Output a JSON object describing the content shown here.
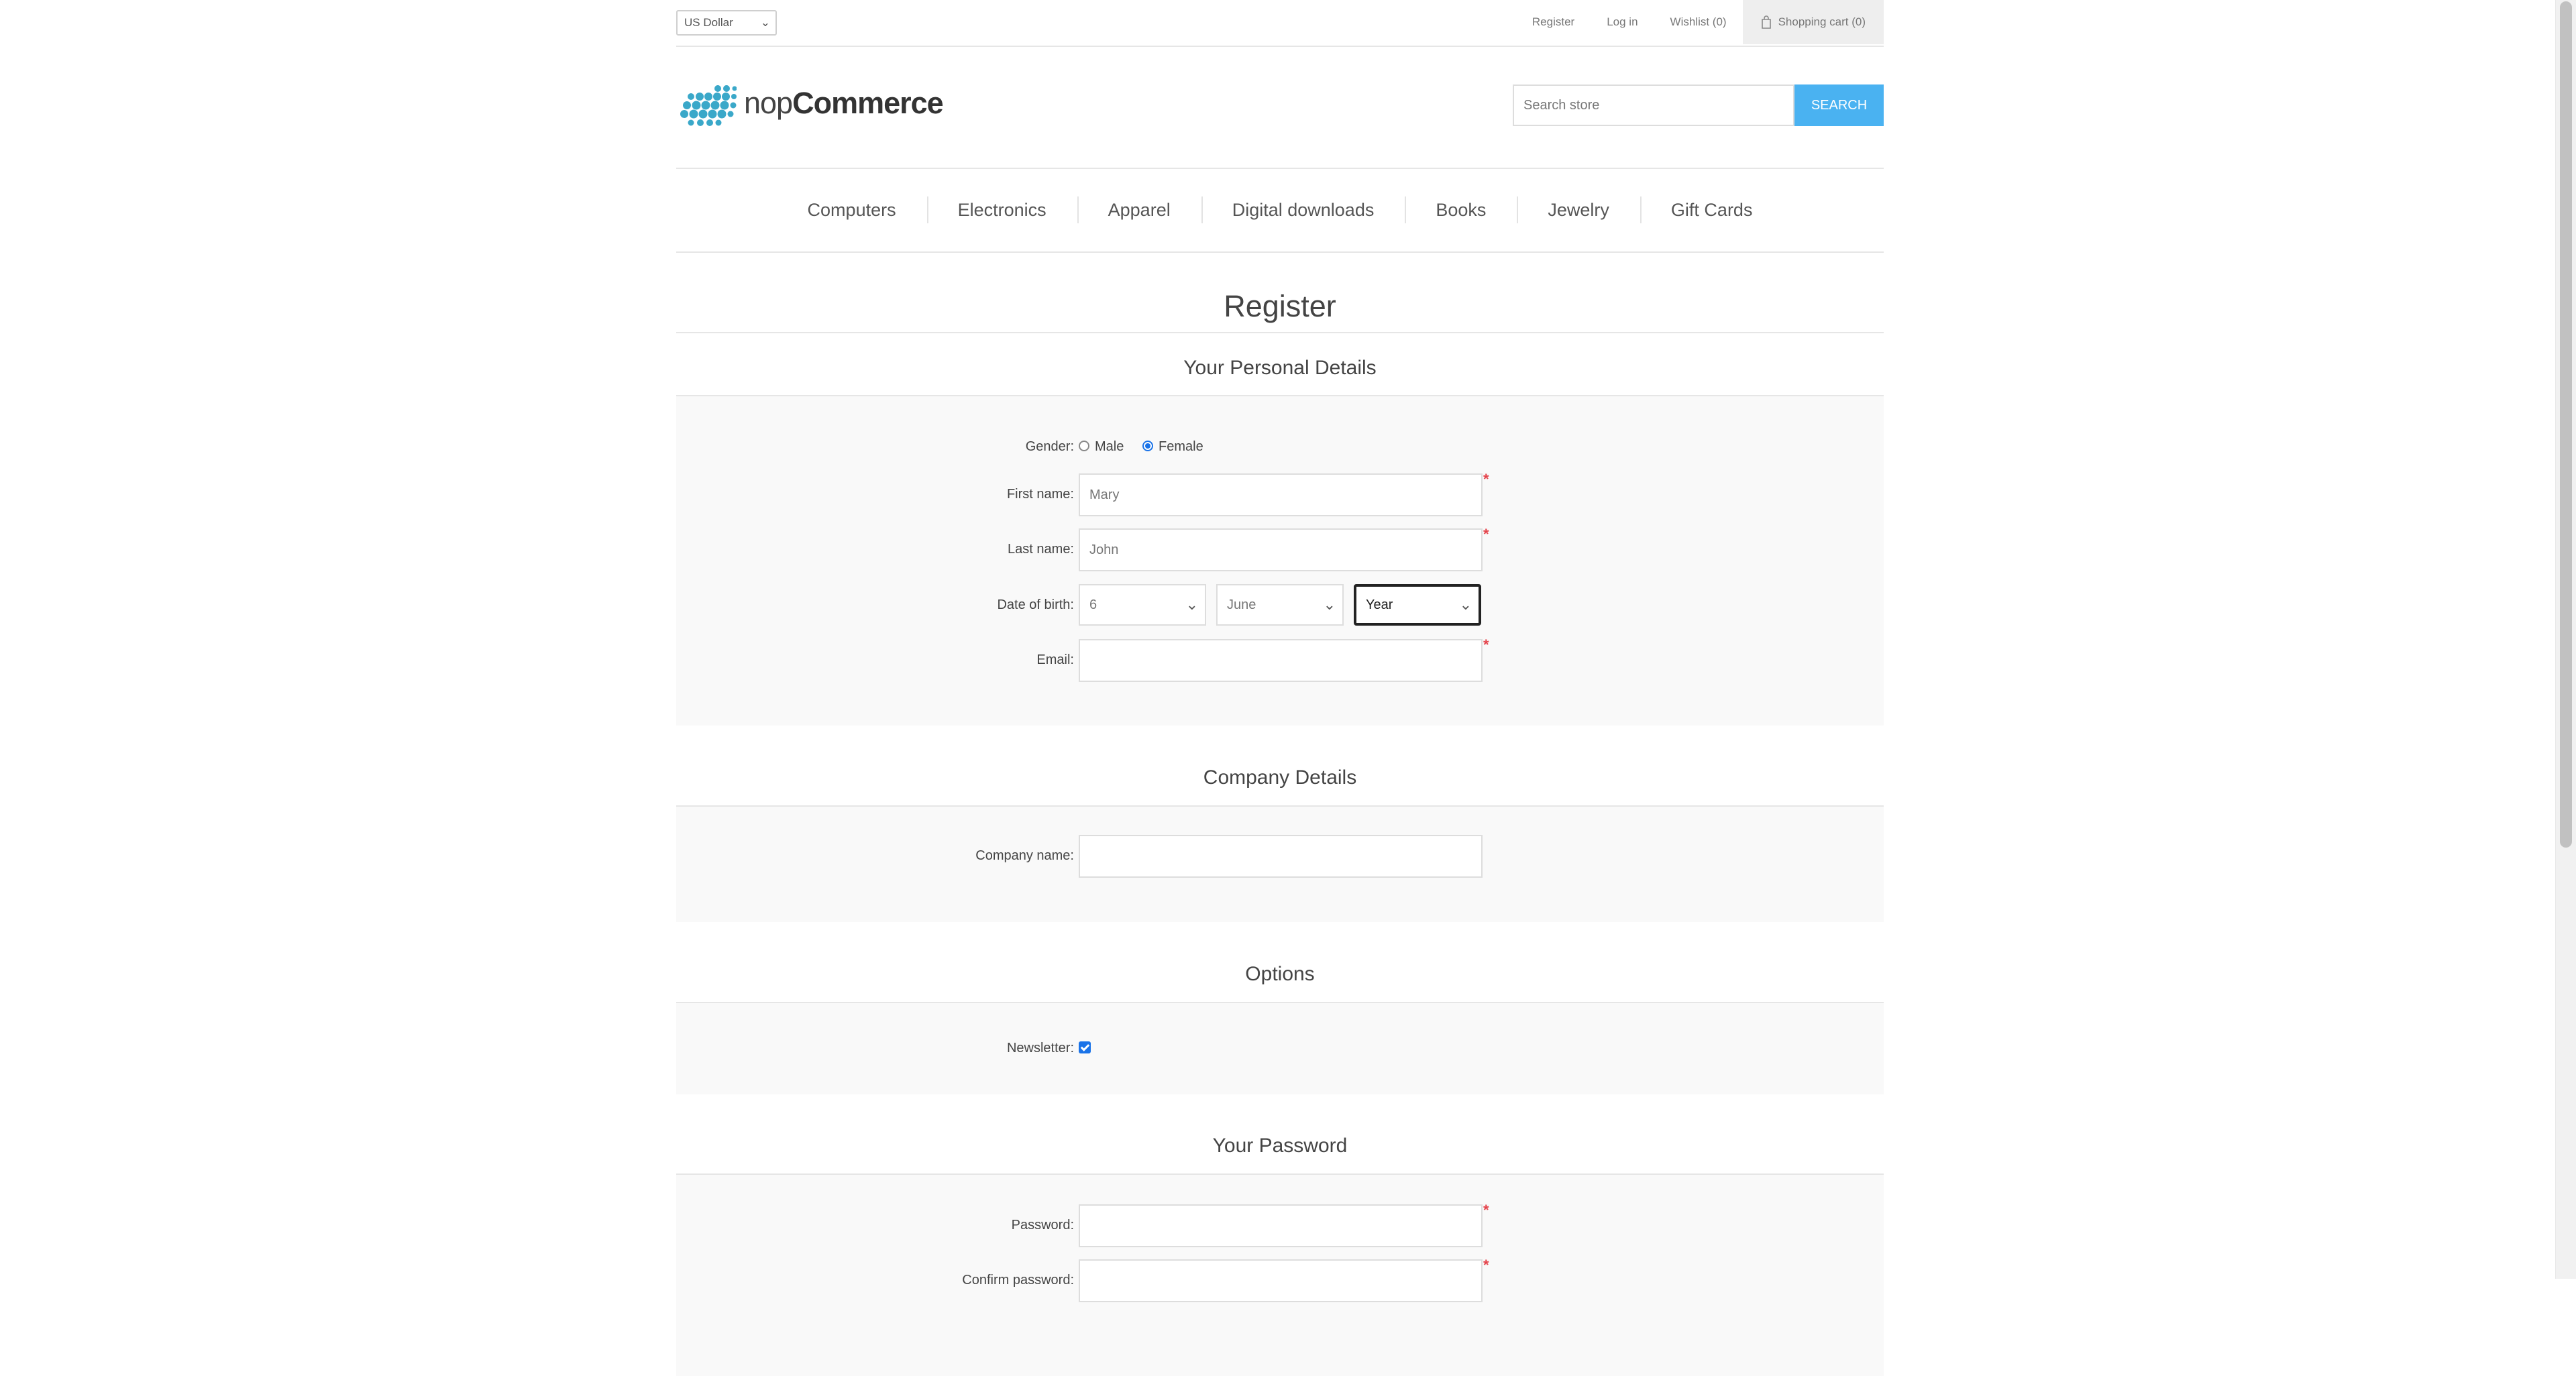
{
  "header": {
    "currency": "US Dollar",
    "links": [
      "Register",
      "Log in",
      "Wishlist (0)"
    ],
    "cart": "Shopping cart (0)"
  },
  "logo": {
    "prefix": "nop",
    "suffix": "Commerce"
  },
  "search": {
    "placeholder": "Search store",
    "button": "SEARCH"
  },
  "menu": [
    "Computers",
    "Electronics",
    "Apparel",
    "Digital downloads",
    "Books",
    "Jewelry",
    "Gift Cards"
  ],
  "page_title": "Register",
  "personal": {
    "title": "Your Personal Details",
    "gender_label": "Gender:",
    "gender_options": [
      "Male",
      "Female"
    ],
    "gender_selected": "Female",
    "first_name_label": "First name:",
    "first_name_value": "Mary",
    "last_name_label": "Last name:",
    "last_name_value": "John",
    "dob_label": "Date of birth:",
    "dob_day": "6",
    "dob_month": "June",
    "dob_year": "Year",
    "email_label": "Email:",
    "email_value": ""
  },
  "company": {
    "title": "Company Details",
    "name_label": "Company name:",
    "name_value": ""
  },
  "options": {
    "title": "Options",
    "newsletter_label": "Newsletter:",
    "newsletter_checked": true
  },
  "password": {
    "title": "Your Password",
    "password_label": "Password:",
    "confirm_label": "Confirm password:"
  },
  "required_mark": "*",
  "colors": {
    "accent": "#4ab2f1",
    "required": "#e4434b",
    "form_bg": "#f9f9f9"
  }
}
